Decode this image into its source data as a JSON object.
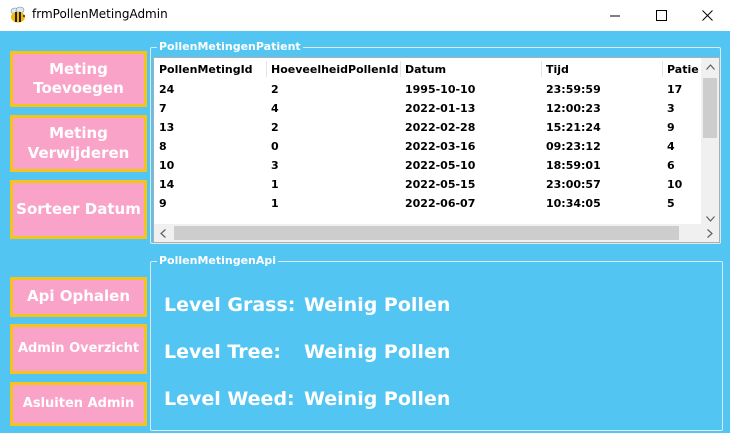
{
  "window": {
    "title": "frmPollenMetingAdmin",
    "app_icon": "bee-icon",
    "controls": {
      "minimize": "—",
      "maximize": "☐",
      "close": "✕"
    }
  },
  "sidebar": {
    "buttons": [
      {
        "label": "Meting Toevoegen"
      },
      {
        "label": "Meting Verwijderen"
      },
      {
        "label": "Sorteer Datum"
      },
      {
        "label": "Api Ophalen"
      },
      {
        "label": "Admin Overzicht"
      },
      {
        "label": "Asluiten Admin"
      }
    ]
  },
  "patient_group": {
    "legend": "PollenMetingenPatient",
    "columns": [
      "PollenMetingId",
      "HoeveelheidPollenId",
      "Datum",
      "Tijd",
      "Patie"
    ],
    "rows": [
      [
        "24",
        "2",
        "1995-10-10",
        "23:59:59",
        "17"
      ],
      [
        "7",
        "4",
        "2022-01-13",
        "12:00:23",
        "3"
      ],
      [
        "13",
        "2",
        "2022-02-28",
        "15:21:24",
        "9"
      ],
      [
        "8",
        "0",
        "2022-03-16",
        "09:23:12",
        "4"
      ],
      [
        "10",
        "3",
        "2022-05-10",
        "18:59:01",
        "6"
      ],
      [
        "14",
        "1",
        "2022-05-15",
        "23:00:57",
        "10"
      ],
      [
        "9",
        "1",
        "2022-06-07",
        "10:34:05",
        "5"
      ]
    ]
  },
  "api_group": {
    "legend": "PollenMetingenApi",
    "levels": [
      {
        "label": "Level Grass:",
        "value": "Weinig Pollen"
      },
      {
        "label": "Level Tree:",
        "value": "Weinig Pollen"
      },
      {
        "label": "Level Weed:",
        "value": "Weinig Pollen"
      }
    ]
  },
  "colors": {
    "background": "#52c5f3",
    "button_fill": "#f9a3c9",
    "button_border": "#f4c31c",
    "text_light": "#ffffff"
  }
}
